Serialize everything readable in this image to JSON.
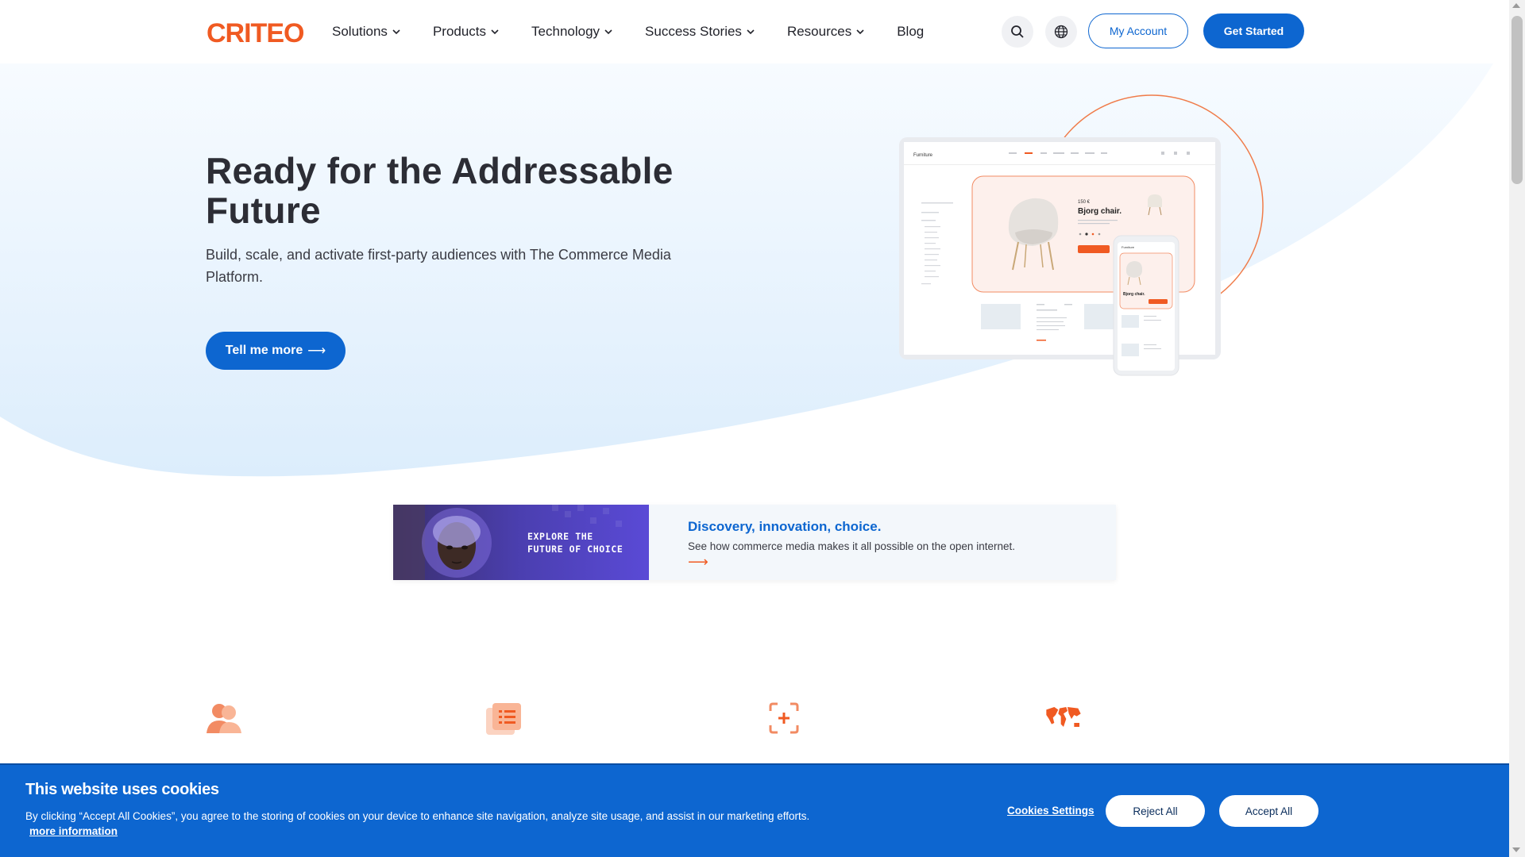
{
  "header": {
    "logo": "CRITEO",
    "nav": [
      {
        "label": "Solutions",
        "has_dropdown": true
      },
      {
        "label": "Products",
        "has_dropdown": true
      },
      {
        "label": "Technology",
        "has_dropdown": true
      },
      {
        "label": "Success Stories",
        "has_dropdown": true
      },
      {
        "label": "Resources",
        "has_dropdown": true
      },
      {
        "label": "Blog",
        "has_dropdown": false
      }
    ],
    "search_icon": "search-icon",
    "language_icon": "globe-icon",
    "my_account": "My Account",
    "get_started": "Get Started"
  },
  "hero": {
    "title": "Ready for the Addressable Future",
    "subtitle": "Build, scale, and activate first-party audiences with The Commerce Media Platform.",
    "cta": "Tell me more",
    "cta_arrow": "⟶",
    "mockup": {
      "store_name": "Furniture",
      "price": "150 €",
      "product_name": "Bjorg chair.",
      "mobile_product_name": "Bjorg chair."
    }
  },
  "banner": {
    "image_text_line1": "EXPLORE THE",
    "image_text_line2": "FUTURE OF CHOICE",
    "title": "Discovery, innovation, choice.",
    "description": "See how commerce media makes it all possible on the open internet.",
    "arrow": "⟶"
  },
  "features": {
    "icons": [
      "audience-icon",
      "catalog-icon",
      "add-focus-icon",
      "world-map-icon"
    ]
  },
  "cookie_banner": {
    "title": "This website uses cookies",
    "text": "By clicking “Accept All Cookies”, you agree to the storing of cookies on your device to enhance site navigation, analyze site usage, and assist in our marketing efforts.",
    "more_info": "more information",
    "settings": "Cookies Settings",
    "reject": "Reject All",
    "accept": "Accept All"
  },
  "colors": {
    "brand_orange": "#f05a22",
    "primary_blue": "#0d66d0",
    "hero_bg": "#e4f1fd"
  }
}
